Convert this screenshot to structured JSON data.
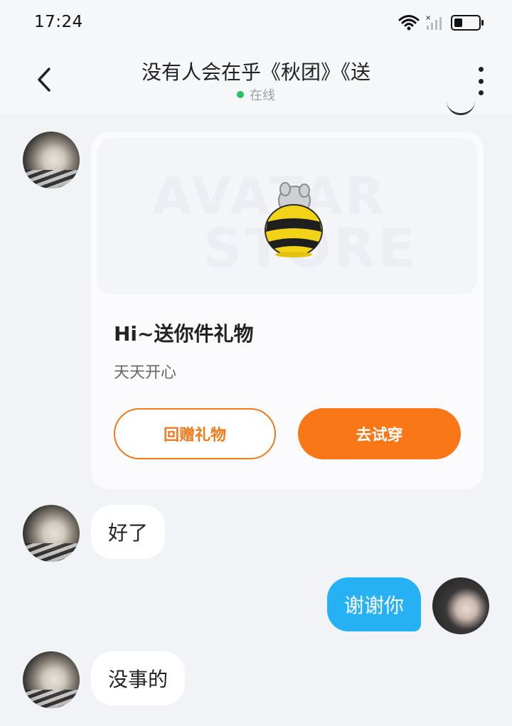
{
  "status_bar": {
    "time": "17:24",
    "battery_level": 0.35,
    "icons": [
      "wifi-icon",
      "signal-icon",
      "battery-icon"
    ]
  },
  "header": {
    "title": "没有人会在乎《秋团》《送",
    "presence": "在线",
    "icons": [
      "chevron-left-icon",
      "more-vertical-icon"
    ]
  },
  "gift_card": {
    "watermark_line1": "AVATAR",
    "watermark_line2": "STORE",
    "title": "Hi~送你件礼物",
    "subtitle": "天天开心",
    "return_gift_label": "回赠礼物",
    "try_on_label": "去试穿"
  },
  "messages": [
    {
      "side": "in",
      "text": "好了"
    },
    {
      "side": "out",
      "text": "谢谢你"
    },
    {
      "side": "in",
      "text": "没事的"
    }
  ],
  "colors": {
    "accent_orange": "#f97717",
    "outgoing_bubble": "#27b1f5",
    "online_dot": "#22c55e",
    "background": "#f1f3f7"
  }
}
